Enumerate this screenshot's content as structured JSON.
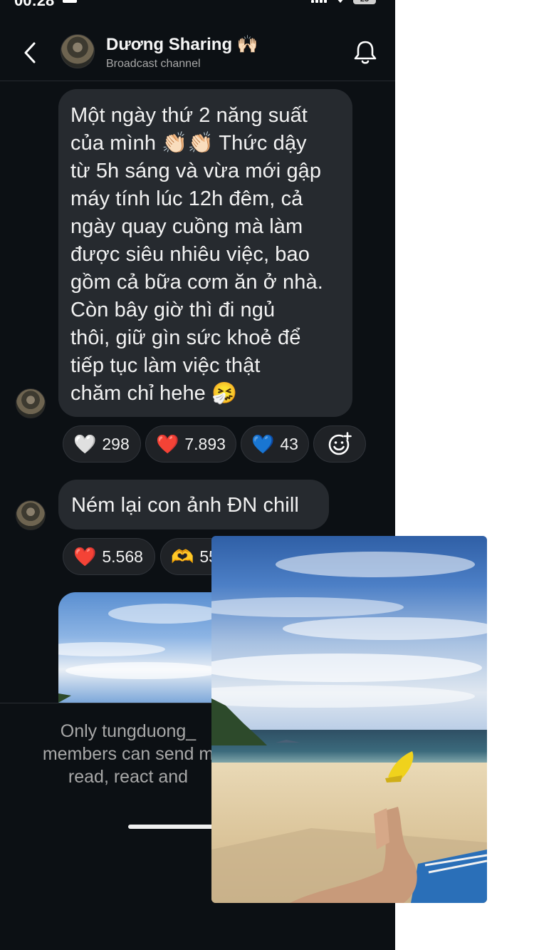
{
  "status_bar": {
    "time": "00:28",
    "battery": "25"
  },
  "header": {
    "title": "Dương Sharing 🙌🏻",
    "subtitle": "Broadcast channel"
  },
  "messages": [
    {
      "text": "Một ngày thứ 2 năng suất của mình 👏🏻👏🏻 Thức dậy từ 5h sáng và vừa mới gập máy tính lúc 12h đêm, cả ngày quay cuồng mà làm được siêu nhiêu việc, bao gồm cả bữa cơm ăn ở nhà. Còn bây giờ thì đi ngủ thôi, giữ gìn sức khoẻ để tiếp tục làm việc thật chăm chỉ hehe 🤧",
      "lines": [
        "Một ngày thứ 2 năng suất",
        "của mình 👏🏻👏🏻 Thức dậy",
        "từ 5h sáng và vừa mới gập",
        "máy tính lúc 12h đêm, cả",
        "ngày quay cuồng mà làm",
        "được siêu nhiêu việc, bao",
        "gồm cả bữa cơm ăn ở nhà.",
        "Còn bây giờ thì đi ngủ",
        "thôi, giữ gìn sức khoẻ để",
        "tiếp tục làm việc thật",
        "chăm chỉ hehe 🤧"
      ],
      "reactions": [
        {
          "emoji": "🤍",
          "count": "298"
        },
        {
          "emoji": "❤️",
          "count": "7.893"
        },
        {
          "emoji": "💙",
          "count": "43"
        }
      ]
    },
    {
      "text": "Ném lại con ảnh ĐN chill",
      "reactions": [
        {
          "emoji": "❤️",
          "count": "5.568"
        },
        {
          "emoji": "🫶",
          "count": "55"
        }
      ]
    }
  ],
  "footer": {
    "text": "Only tungduong_\nmembers can send m\nread, react and"
  },
  "icons": {
    "back": "chevron-left-icon",
    "bell": "bell-icon",
    "add_reaction": "add-reaction-icon"
  }
}
